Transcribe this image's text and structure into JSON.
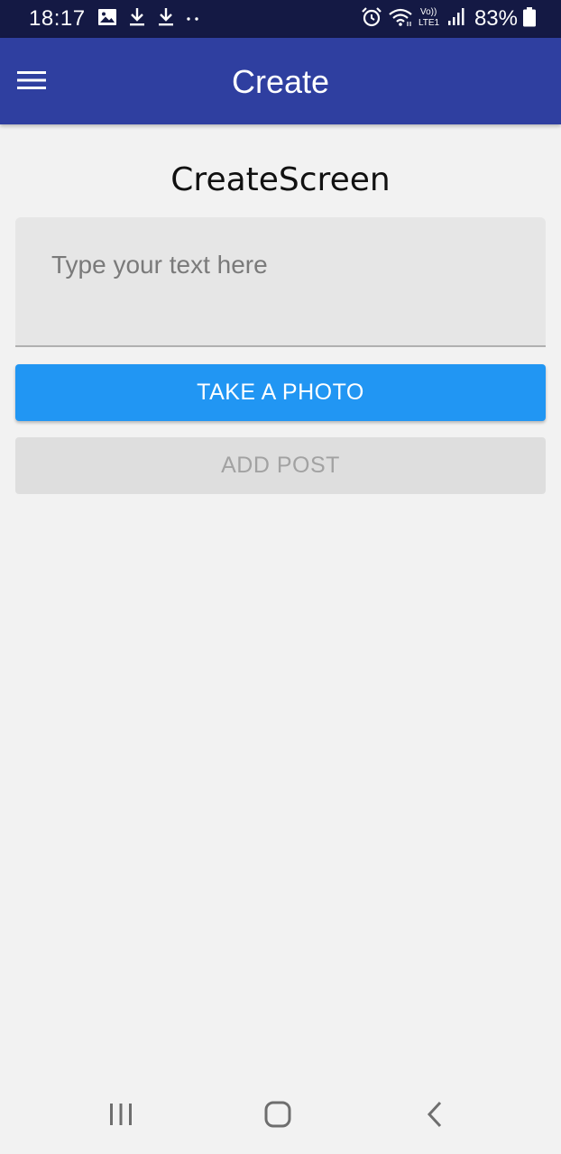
{
  "status_bar": {
    "time": "18:17",
    "battery_percent": "83%",
    "left_icons": [
      "image-icon",
      "download-icon",
      "download-icon",
      "more-dots-icon"
    ],
    "right_icons": [
      "alarm-icon",
      "wifi-icon",
      "volte-lte-icon",
      "signal-icon",
      "battery-icon"
    ],
    "volte_label_top": "Vo))",
    "volte_label_bottom": "LTE1"
  },
  "app_bar": {
    "title": "Create",
    "menu_icon": "hamburger-menu-icon",
    "color": "#2f3fa0"
  },
  "main": {
    "heading": "CreateScreen",
    "text_input": {
      "placeholder": "Type your text here",
      "value": ""
    },
    "take_photo_label": "TAKE A PHOTO",
    "add_post_label": "ADD POST",
    "accent_color": "#2196f3"
  },
  "nav_bar": {
    "items": [
      "recent-apps-icon",
      "home-icon",
      "back-icon"
    ]
  }
}
